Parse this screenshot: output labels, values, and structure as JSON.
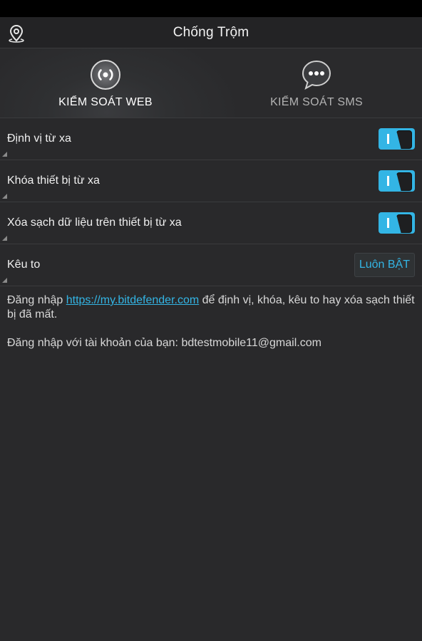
{
  "app": {
    "title": "Chống Trộm"
  },
  "tabs": [
    {
      "label": "KIỂM SOÁT WEB",
      "icon": "radio-signal-icon",
      "selected": true
    },
    {
      "label": "KIỂM SOÁT SMS",
      "icon": "chat-bubble-icon",
      "selected": false
    }
  ],
  "settings": [
    {
      "label": "Định vị từ xa",
      "control": "toggle",
      "state": "on"
    },
    {
      "label": "Khóa thiết bị từ xa",
      "control": "toggle",
      "state": "on"
    },
    {
      "label": "Xóa sạch dữ liệu trên thiết bị từ xa",
      "control": "toggle",
      "state": "on"
    },
    {
      "label": "Kêu to",
      "control": "button",
      "value": "Luôn BẬT"
    }
  ],
  "info": {
    "line1_prefix": "Đăng nhập ",
    "link": "https://my.bitdefender.com",
    "line1_suffix": " để định vị, khóa, kêu to hay xóa sạch thiết bị đã mất.",
    "line2": "Đăng nhập với tài khoản của bạn: bdtestmobile11@gmail.com"
  },
  "colors": {
    "accent": "#33b5e5",
    "background": "#29292b",
    "action_bar": "#232325"
  },
  "icons": {
    "action_bar": "location-pin-icon"
  }
}
